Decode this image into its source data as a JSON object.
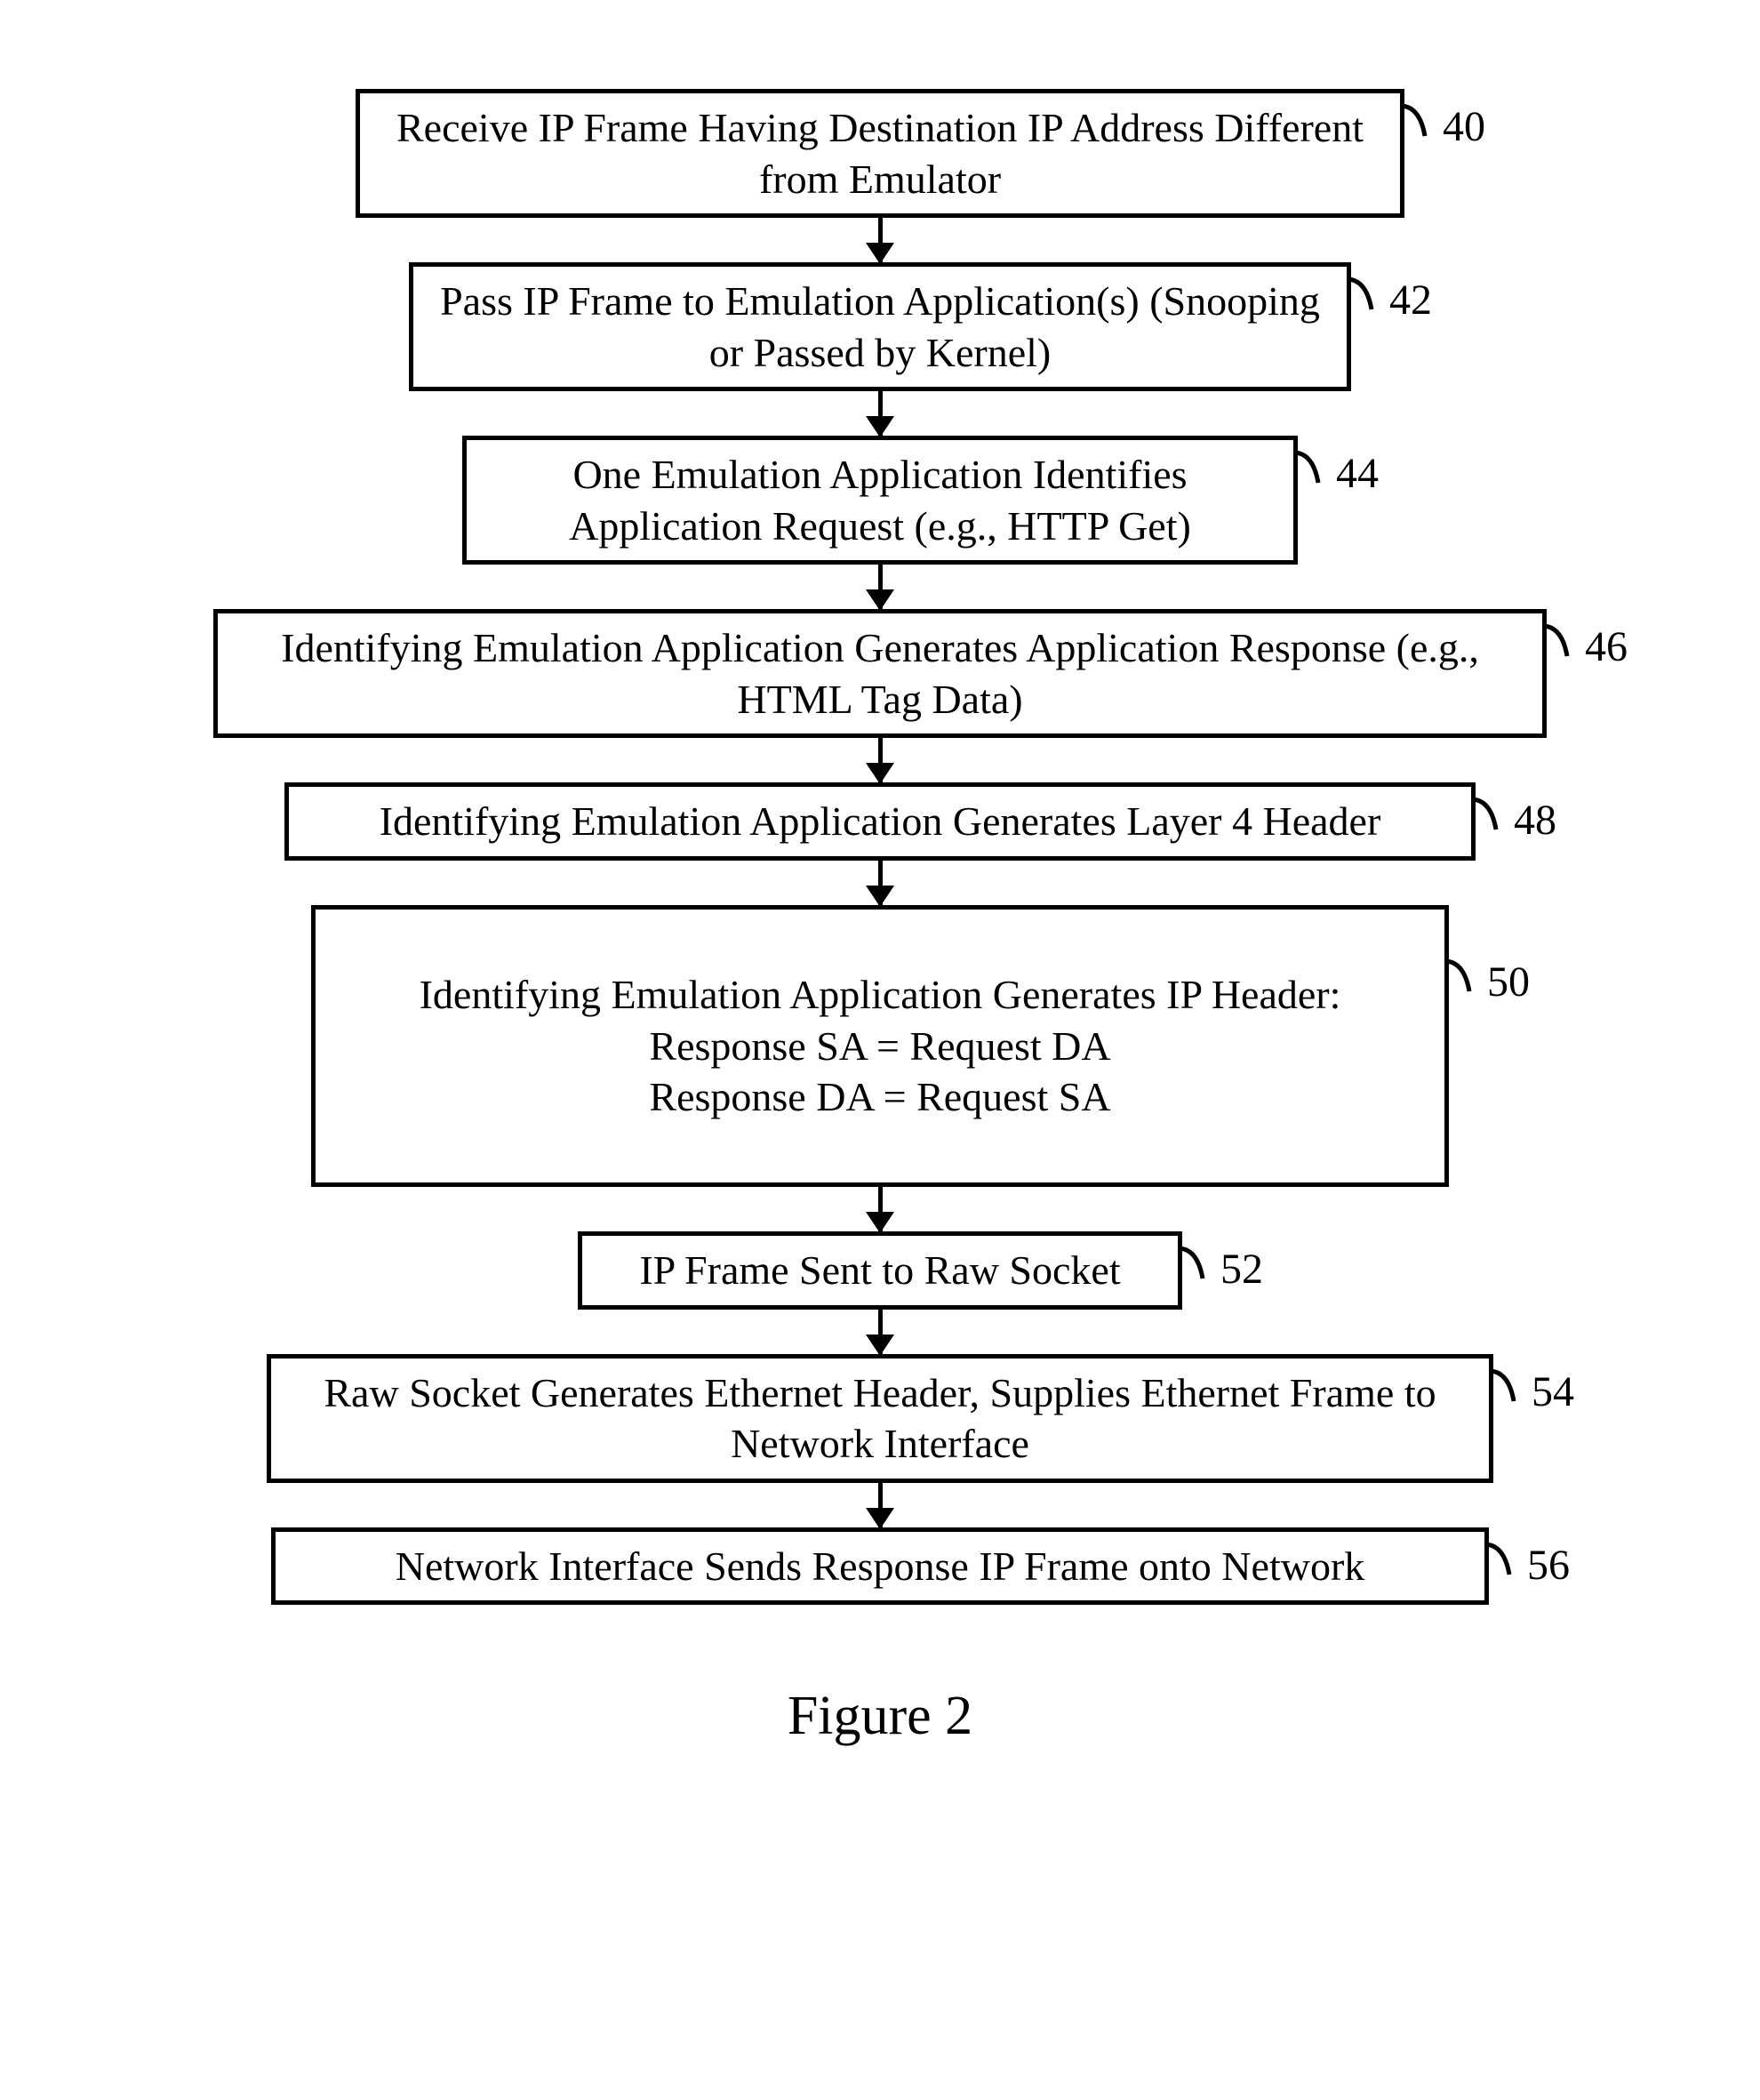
{
  "chart_data": {
    "type": "flowchart",
    "title": "Figure 2",
    "steps": [
      {
        "id": "40",
        "text": "Receive IP Frame Having Destination IP Address Different from Emulator"
      },
      {
        "id": "42",
        "text": "Pass IP Frame to Emulation Application(s) (Snooping or Passed by Kernel)"
      },
      {
        "id": "44",
        "text": "One Emulation Application Identifies Application Request (e.g., HTTP Get)"
      },
      {
        "id": "46",
        "text": "Identifying Emulation Application Generates Application Response (e.g., HTML Tag Data)"
      },
      {
        "id": "48",
        "text": "Identifying Emulation Application Generates Layer 4 Header"
      },
      {
        "id": "50",
        "text": "Identifying Emulation Application Generates IP Header:\nResponse SA = Request DA\nResponse DA = Request SA"
      },
      {
        "id": "52",
        "text": "IP Frame Sent to Raw Socket"
      },
      {
        "id": "54",
        "text": "Raw Socket Generates Ethernet Header, Supplies Ethernet Frame to Network Interface"
      },
      {
        "id": "56",
        "text": "Network Interface Sends Response IP Frame onto Network"
      }
    ]
  },
  "caption": "Figure 2"
}
